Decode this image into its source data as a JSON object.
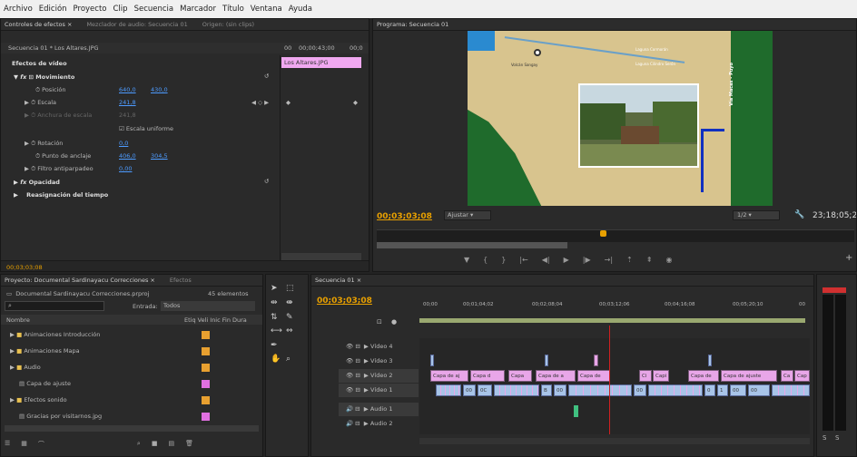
{
  "menu": [
    "Archivo",
    "Edición",
    "Proyecto",
    "Clip",
    "Secuencia",
    "Marcador",
    "Título",
    "Ventana",
    "Ayuda"
  ],
  "effect_tabs": {
    "tab1": "Controles de efectos ×",
    "tab2": "Mezclador de audio: Secuencia 01",
    "tab3": "Origen: (sin clips)"
  },
  "effects": {
    "sequence": "Secuencia 01 * Los Altares.JPG",
    "tc_start": "00",
    "tc_mid": "00;00;43;00",
    "tc_end": "00;0",
    "clip_label": "Los Altares.JPG",
    "video_effects": "Efectos de vídeo",
    "movimiento": "Movimiento",
    "posicion": "Posición",
    "pos_x": "640,0",
    "pos_y": "430,0",
    "escala": "Escala",
    "escala_val": "241,8",
    "anchura": "Anchura de escala",
    "anchura_val": "241,8",
    "uniforme": "Escala uniforme",
    "rotacion": "Rotación",
    "rot_val": "0,0",
    "anclaje": "Punto de anclaje",
    "anc_x": "406,0",
    "anc_y": "304,5",
    "filtro": "Filtro antiparpadeo",
    "filtro_val": "0,00",
    "opacidad": "Opacidad",
    "reasignacion": "Reasignación del tiempo",
    "bottom_tc": "00;03;03;08"
  },
  "program": {
    "tab": "Programa: Secuencia 01",
    "timecode": "00;03;03;08",
    "fit": "Ajustar",
    "scale": "1/2",
    "duration": "23;18;05;2",
    "map_labels": [
      "Volcán Sangay",
      "Laguna Cormorán",
      "Laguna Cilindro Serón",
      "Vía Macas - Puyo"
    ]
  },
  "project": {
    "tab": "Proyecto: Documental Sardinayacu Correcciones ×",
    "tab2": "Efectos",
    "file": "Documental Sardinayacu Correcciones.prproj",
    "count": "45 elementos",
    "entrada_label": "Entrada:",
    "entrada_value": "Todos",
    "col_name": "Nombre",
    "col_rest": "Etiq Veli Inic Fin Dura",
    "items": [
      {
        "name": "Animaciones Introducción",
        "color": "#e8a030"
      },
      {
        "name": "Animaciones Mapa",
        "color": "#e8a030"
      },
      {
        "name": "Audio",
        "color": "#e8a030"
      },
      {
        "name": "Capa de ajuste",
        "color": "#e070e0"
      },
      {
        "name": "Efectos sonido",
        "color": "#e8a030"
      },
      {
        "name": "Gracias por visitarnos.jpg",
        "color": "#e070e0"
      }
    ]
  },
  "timeline": {
    "tab": "Secuencia 01 ×",
    "timecode": "00;03;03;08",
    "ruler": [
      "00;00",
      "00;01;04;02",
      "00;02;08;04",
      "00;03;12;06",
      "00;04;16;08",
      "00;05;20;10",
      "00"
    ],
    "tracks": [
      "Vídeo 4",
      "Vídeo 3",
      "Vídeo 2",
      "Vídeo 1",
      "Audio 1",
      "Audio 2"
    ],
    "v2_clips": [
      "Capa de aj",
      "Capa d",
      "Capa",
      "Capa de a",
      "Capa de",
      "Ci",
      "Capi",
      "Capa de",
      "Capa de ajuste",
      "Ca",
      "Cap"
    ],
    "v1_clips": [
      "00",
      "0C",
      "B",
      "00",
      "00",
      "0",
      "1",
      "00",
      "00"
    ]
  }
}
